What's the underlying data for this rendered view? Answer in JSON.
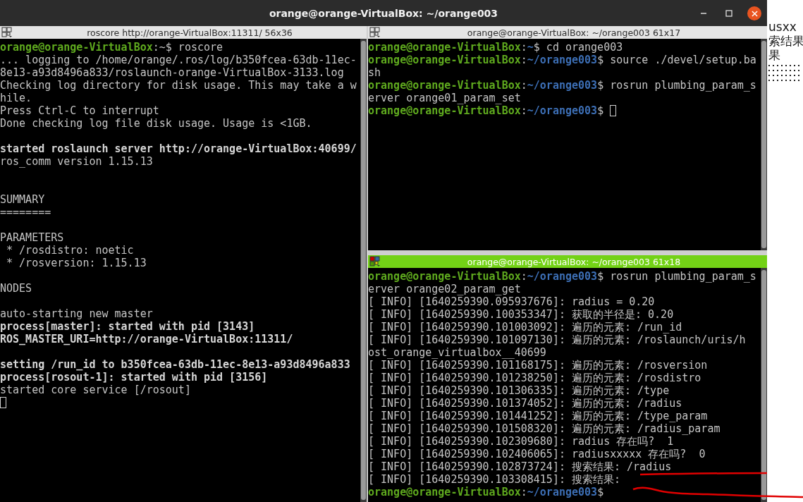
{
  "window": {
    "title": "orange@orange-VirtualBox: ~/orange003"
  },
  "panes": [
    {
      "title": "roscore http://orange-VirtualBox:11311/ 56x36",
      "active": false,
      "cursor_visible": true,
      "lines": [
        {
          "kind": "text",
          "segments": [
            {
              "kind": "user",
              "text": "orange@orange-VirtualBox"
            },
            {
              "kind": "plain",
              "text": ":~$ roscore"
            }
          ]
        },
        {
          "kind": "text",
          "segments": [
            {
              "kind": "plain",
              "text": "... logging to /home/orange/.ros/log/b350fcea-63db-11ec-"
            }
          ]
        },
        {
          "kind": "text",
          "segments": [
            {
              "kind": "plain",
              "text": "8e13-a93d8496a833/roslaunch-orange-VirtualBox-3133.log"
            }
          ]
        },
        {
          "kind": "text",
          "segments": [
            {
              "kind": "plain",
              "text": "Checking log directory for disk usage. This may take a w"
            }
          ]
        },
        {
          "kind": "text",
          "segments": [
            {
              "kind": "plain",
              "text": "hile."
            }
          ]
        },
        {
          "kind": "text",
          "segments": [
            {
              "kind": "plain",
              "text": "Press Ctrl-C to interrupt"
            }
          ]
        },
        {
          "kind": "text",
          "segments": [
            {
              "kind": "plain",
              "text": "Done checking log file disk usage. Usage is <1GB."
            }
          ]
        },
        {
          "kind": "blank"
        },
        {
          "kind": "text",
          "segments": [
            {
              "kind": "bold",
              "text": "started roslaunch server http://orange-VirtualBox:40699/"
            }
          ]
        },
        {
          "kind": "text",
          "segments": [
            {
              "kind": "plain",
              "text": "ros_comm version 1.15.13"
            }
          ]
        },
        {
          "kind": "blank"
        },
        {
          "kind": "blank"
        },
        {
          "kind": "text",
          "segments": [
            {
              "kind": "plain",
              "text": "SUMMARY"
            }
          ]
        },
        {
          "kind": "text",
          "segments": [
            {
              "kind": "plain",
              "text": "========"
            }
          ]
        },
        {
          "kind": "blank"
        },
        {
          "kind": "text",
          "segments": [
            {
              "kind": "plain",
              "text": "PARAMETERS"
            }
          ]
        },
        {
          "kind": "text",
          "segments": [
            {
              "kind": "plain",
              "text": " * /rosdistro: noetic"
            }
          ]
        },
        {
          "kind": "text",
          "segments": [
            {
              "kind": "plain",
              "text": " * /rosversion: 1.15.13"
            }
          ]
        },
        {
          "kind": "blank"
        },
        {
          "kind": "text",
          "segments": [
            {
              "kind": "plain",
              "text": "NODES"
            }
          ]
        },
        {
          "kind": "blank"
        },
        {
          "kind": "text",
          "segments": [
            {
              "kind": "plain",
              "text": "auto-starting new master"
            }
          ]
        },
        {
          "kind": "text",
          "segments": [
            {
              "kind": "bold",
              "text": "process[master]: started with pid [3143]"
            }
          ]
        },
        {
          "kind": "text",
          "segments": [
            {
              "kind": "bold",
              "text": "ROS_MASTER_URI=http://orange-VirtualBox:11311/"
            }
          ]
        },
        {
          "kind": "blank"
        },
        {
          "kind": "text",
          "segments": [
            {
              "kind": "bold",
              "text": "setting /run_id to b350fcea-63db-11ec-8e13-a93d8496a833"
            }
          ]
        },
        {
          "kind": "text",
          "segments": [
            {
              "kind": "bold",
              "text": "process[rosout-1]: started with pid [3156]"
            }
          ]
        },
        {
          "kind": "text",
          "segments": [
            {
              "kind": "plain",
              "text": "started core service [/rosout]"
            }
          ]
        },
        {
          "kind": "blank"
        }
      ]
    },
    {
      "title": "orange@orange-VirtualBox: ~/orange003 61x17",
      "active": false,
      "cursor_visible": true,
      "lines": [
        {
          "kind": "text",
          "segments": [
            {
              "kind": "user",
              "text": "orange@orange-VirtualBox"
            },
            {
              "kind": "plain",
              "text": ":"
            },
            {
              "kind": "path",
              "text": "~"
            },
            {
              "kind": "plain",
              "text": "$ cd orange003"
            }
          ]
        },
        {
          "kind": "text",
          "segments": [
            {
              "kind": "user",
              "text": "orange@orange-VirtualBox"
            },
            {
              "kind": "plain",
              "text": ":"
            },
            {
              "kind": "path",
              "text": "~/orange003"
            },
            {
              "kind": "plain",
              "text": "$ source ./devel/setup.ba"
            }
          ]
        },
        {
          "kind": "text",
          "segments": [
            {
              "kind": "plain",
              "text": "sh"
            }
          ]
        },
        {
          "kind": "text",
          "segments": [
            {
              "kind": "user",
              "text": "orange@orange-VirtualBox"
            },
            {
              "kind": "plain",
              "text": ":"
            },
            {
              "kind": "path",
              "text": "~/orange003"
            },
            {
              "kind": "plain",
              "text": "$ rosrun plumbing_param_s"
            }
          ]
        },
        {
          "kind": "text",
          "segments": [
            {
              "kind": "plain",
              "text": "erver orange01_param_set"
            }
          ]
        },
        {
          "kind": "text",
          "segments": [
            {
              "kind": "user",
              "text": "orange@orange-VirtualBox"
            },
            {
              "kind": "plain",
              "text": ":"
            },
            {
              "kind": "path",
              "text": "~/orange003"
            },
            {
              "kind": "plain",
              "text": "$ "
            }
          ]
        }
      ]
    },
    {
      "title": "orange@orange-VirtualBox: ~/orange003 61x18",
      "active": true,
      "cursor_visible": false,
      "lines": [
        {
          "kind": "text",
          "segments": [
            {
              "kind": "user",
              "text": "orange@orange-VirtualBox"
            },
            {
              "kind": "plain",
              "text": ":"
            },
            {
              "kind": "path",
              "text": "~/orange003"
            },
            {
              "kind": "plain",
              "text": "$ rosrun plumbing_param_s"
            }
          ]
        },
        {
          "kind": "text",
          "segments": [
            {
              "kind": "plain",
              "text": "erver orange02_param_get"
            }
          ]
        },
        {
          "kind": "text",
          "segments": [
            {
              "kind": "plain",
              "text": "[ INFO] [1640259390.095937676]: radius = 0.20"
            }
          ]
        },
        {
          "kind": "text",
          "segments": [
            {
              "kind": "plain",
              "text": "[ INFO] [1640259390.100353347]: 获取的半径是: 0.20"
            }
          ]
        },
        {
          "kind": "text",
          "segments": [
            {
              "kind": "plain",
              "text": "[ INFO] [1640259390.101003092]: 遍历的元素: /run_id"
            }
          ]
        },
        {
          "kind": "text",
          "segments": [
            {
              "kind": "plain",
              "text": "[ INFO] [1640259390.101097130]: 遍历的元素: /roslaunch/uris/h"
            }
          ]
        },
        {
          "kind": "text",
          "segments": [
            {
              "kind": "plain",
              "text": "ost_orange_virtualbox__40699"
            }
          ]
        },
        {
          "kind": "text",
          "segments": [
            {
              "kind": "plain",
              "text": "[ INFO] [1640259390.101168175]: 遍历的元素: /rosversion"
            }
          ]
        },
        {
          "kind": "text",
          "segments": [
            {
              "kind": "plain",
              "text": "[ INFO] [1640259390.101238250]: 遍历的元素: /rosdistro"
            }
          ]
        },
        {
          "kind": "text",
          "segments": [
            {
              "kind": "plain",
              "text": "[ INFO] [1640259390.101306335]: 遍历的元素: /type"
            }
          ]
        },
        {
          "kind": "text",
          "segments": [
            {
              "kind": "plain",
              "text": "[ INFO] [1640259390.101374052]: 遍历的元素: /radius"
            }
          ]
        },
        {
          "kind": "text",
          "segments": [
            {
              "kind": "plain",
              "text": "[ INFO] [1640259390.101441252]: 遍历的元素: /type_param"
            }
          ]
        },
        {
          "kind": "text",
          "segments": [
            {
              "kind": "plain",
              "text": "[ INFO] [1640259390.101508320]: 遍历的元素: /radius_param"
            }
          ]
        },
        {
          "kind": "text",
          "segments": [
            {
              "kind": "plain",
              "text": "[ INFO] [1640259390.102309680]: radius 存在吗?  1"
            }
          ]
        },
        {
          "kind": "text",
          "segments": [
            {
              "kind": "plain",
              "text": "[ INFO] [1640259390.102406065]: radiusxxxxx 存在吗?  0"
            }
          ]
        },
        {
          "kind": "text",
          "segments": [
            {
              "kind": "plain",
              "text": "[ INFO] [1640259390.102873724]: 搜索结果: /radius"
            }
          ]
        },
        {
          "kind": "text",
          "segments": [
            {
              "kind": "plain",
              "text": "[ INFO] [1640259390.103308415]: 搜索结果:"
            }
          ]
        },
        {
          "kind": "text",
          "segments": [
            {
              "kind": "user",
              "text": "orange@orange-VirtualBox"
            },
            {
              "kind": "plain",
              "text": ":"
            },
            {
              "kind": "path",
              "text": "~/orange003"
            },
            {
              "kind": "plain",
              "text": "$ "
            }
          ]
        }
      ]
    }
  ],
  "background_window": {
    "lines": [
      "usxx",
      "索结果",
      "果"
    ]
  }
}
